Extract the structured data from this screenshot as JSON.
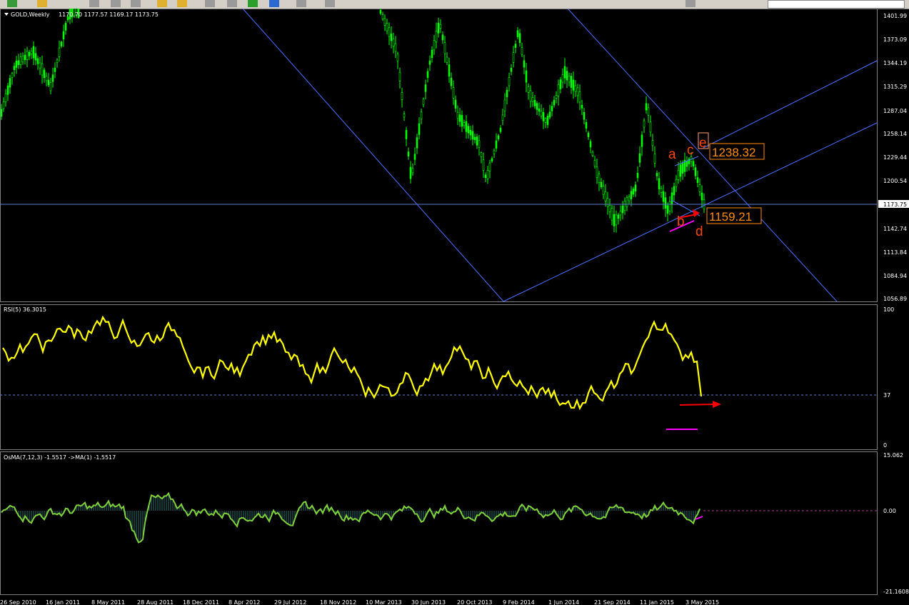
{
  "chart_window": {
    "symbol_title": "GOLD,Weekly",
    "ohlc": "1170.70 1177.57 1169.17 1173.75",
    "colors": {
      "background": "#000000",
      "candle_up": "#00ff00",
      "candle_down": "#00ff00",
      "trendline": "#4a6fff",
      "rsi_line": "#ffff00",
      "osma_line": "#7fd13b",
      "osma_hist": "#2f6f6f",
      "annotation": "#ff4500",
      "price_box": "#ff8c00",
      "arrow": "#ff0000",
      "magenta": "#ff00ff"
    },
    "price_axis": [
      "1401.99",
      "1373.09",
      "1344.19",
      "1315.29",
      "1287.04",
      "1258.14",
      "1229.44",
      "1200.54",
      "1173.75",
      "1142.74",
      "1113.84",
      "1084.94",
      "1056.89"
    ],
    "current_price": "1173.75",
    "date_axis": [
      "26 Sep 2010",
      "16 Jan 2011",
      "8 May 2011",
      "28 Aug 2011",
      "18 Dec 2011",
      "8 Apr 2012",
      "29 Jul 2012",
      "18 Nov 2012",
      "10 Mar 2013",
      "30 Jun 2013",
      "20 Oct 2013",
      "9 Feb 2014",
      "1 Jun 2014",
      "21 Sep 2014",
      "11 Jan 2015",
      "3 May 2015"
    ],
    "annotations": {
      "a": "a",
      "b": "b",
      "c": "c",
      "d": "d",
      "e": "e",
      "price_high": "1238.32",
      "price_low": "1159.21"
    }
  },
  "rsi_panel": {
    "title": "RSI(5) 36.3015",
    "levels": [
      "100",
      "37",
      "0"
    ]
  },
  "osma_panel": {
    "title": "OsMA(7,12,3) -1.5517  ->MA(1) -1.5517",
    "levels": [
      "15.062",
      "0.00",
      "-21.1608"
    ]
  }
}
